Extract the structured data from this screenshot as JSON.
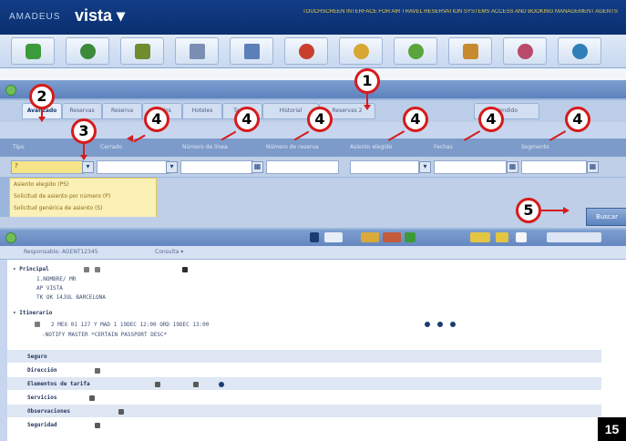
{
  "header": {
    "brand_small": "AMADEUS",
    "brand_large": "vista ▾",
    "notice": "TOUCHSCREEN INTERFACE FOR AIR TRAVEL RESERVATION SYSTEMS ACCESS AND BOOKING MANAGEMENT AGENTS"
  },
  "app_toolbar": {
    "icons": [
      "home-icon",
      "globe-icon",
      "money-icon",
      "wand-icon",
      "book-icon",
      "person-icon",
      "idea-icon",
      "plant-icon",
      "bag-icon",
      "clock-icon",
      "earth-icon"
    ]
  },
  "search_panel": {
    "tabs": [
      "Avanzado",
      "Reservas",
      "Reserva",
      "Vuelos",
      "Hoteles",
      "Tarifas",
      "Historial",
      "Reservas 2",
      "Vendido"
    ],
    "selected_tab": "Avanzado",
    "columns": [
      "Tipo",
      "Cerrado",
      "Número de línea",
      "Número de reserva",
      "Asiento elegido",
      "Fechas",
      "Segmento"
    ],
    "tipo_value": "?",
    "dropdown_items": [
      "Asiento elegido (PS)",
      "Solicitud de asiento por número (P)",
      "Solicitud genérica de asiento (S)"
    ],
    "search_button": "Buscar"
  },
  "pnr": {
    "subtitle_left": "Responsable: AGENT12345",
    "subtitle_right": "Consulta ▾",
    "principal_label": "▾ Principal",
    "principal_lines": [
      "1.NOMBRE/ MR",
      "AP VISTA",
      "TK OK 14JUL BARCELONA"
    ],
    "itinerario_label": "▾ Itinerario",
    "itinerary_line": "2 MEX 01   127  Y  MAD  1  19DEC  12:00   ORD 19DEC  13:00",
    "itinerary_remark": "-NOTIFY MASTER *CERTAIN PASSPORT DESC*",
    "sections": [
      "Seguro",
      "Dirección",
      "Elementos de tarifa",
      "Servicios",
      "Observaciones",
      "Seguridad"
    ]
  },
  "annotations": [
    "1",
    "2",
    "3",
    "4",
    "4",
    "4",
    "4",
    "4",
    "4",
    "5"
  ],
  "page_number": "15",
  "colors": {
    "accent": "#d61b1b",
    "header": "#123d86",
    "panel": "#6d8fc6",
    "dropdown": "#fbf0b6"
  }
}
